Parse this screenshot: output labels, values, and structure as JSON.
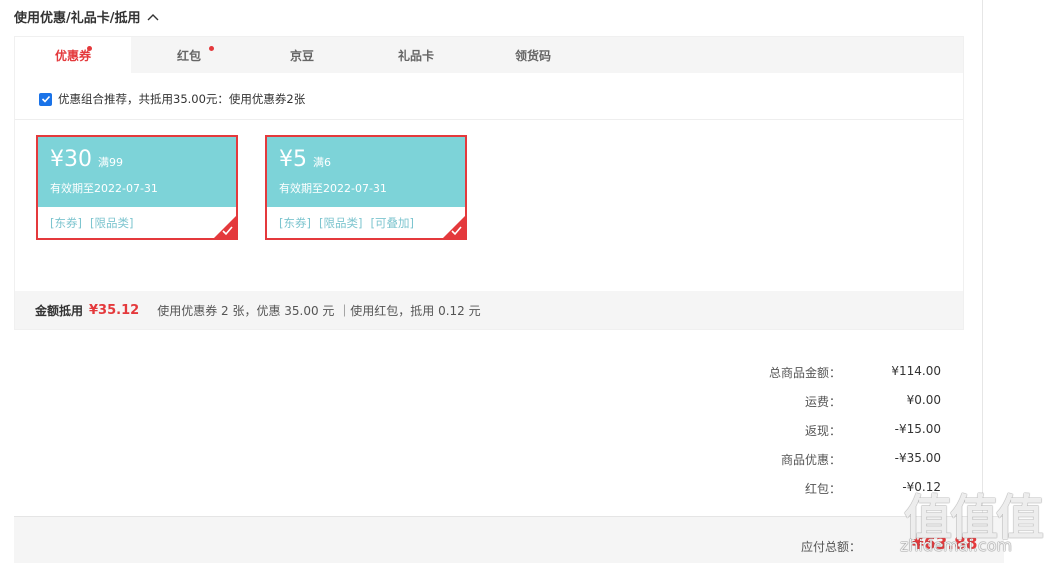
{
  "section": {
    "title": "使用优惠/礼品卡/抵用"
  },
  "tabs": [
    {
      "label": "优惠券",
      "active": true,
      "dot": true
    },
    {
      "label": "红包",
      "active": false,
      "dot": true
    },
    {
      "label": "京豆",
      "active": false,
      "dot": false
    },
    {
      "label": "礼品卡",
      "active": false,
      "dot": false
    },
    {
      "label": "领货码",
      "active": false,
      "dot": false
    }
  ],
  "combo": {
    "checked": true,
    "text": "优惠组合推荐，共抵用35.00元：使用优惠券2张"
  },
  "coupons": [
    {
      "amount": "¥30",
      "condition": "满99",
      "expiry": "有效期至2022-07-31",
      "tags": [
        "[东券]",
        "[限品类]"
      ],
      "selected": true
    },
    {
      "amount": "¥5",
      "condition": "满6",
      "expiry": "有效期至2022-07-31",
      "tags": [
        "[东券]",
        "[限品类]",
        "[可叠加]"
      ],
      "selected": true
    }
  ],
  "summary": {
    "label": "金额抵用",
    "value": "¥35.12",
    "detail": "使用优惠券 2 张，优惠 35.00 元 ｜使用红包，抵用 0.12 元"
  },
  "totals": [
    {
      "label": "总商品金额：",
      "value": "¥114.00"
    },
    {
      "label": "运费：",
      "value": "¥0.00"
    },
    {
      "label": "返现：",
      "value": "-¥15.00"
    },
    {
      "label": "商品优惠：",
      "value": "-¥35.00"
    },
    {
      "label": "红包：",
      "value": "-¥0.12"
    }
  ],
  "payable": {
    "label": "应付总额：",
    "value": "¥63.88"
  },
  "watermark": {
    "big": "值值值",
    "small": "zhidemai.com"
  },
  "colors": {
    "accent": "#e4393c",
    "coupon_bg": "#7dd3d8",
    "tag": "#7dc5cf"
  }
}
